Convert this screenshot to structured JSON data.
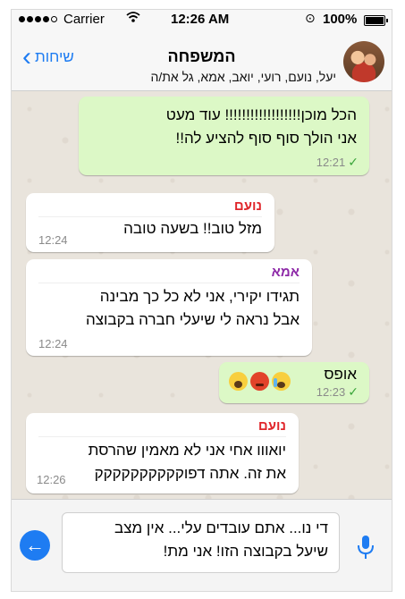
{
  "status_bar": {
    "carrier": "Carrier",
    "time": "12:26 AM",
    "battery": "100%"
  },
  "header": {
    "back_label": "שיחות",
    "title": "המשפחה",
    "members": "יעל, נועם, רועי, יואב, אמא, גל את/ה"
  },
  "messages": [
    {
      "direction": "out",
      "lines": [
        "הכל מוכן!!!!!!!!!!!!!!!!!! עוד מעט",
        "אני הולך סוף סוף להציע לה!!"
      ],
      "time": "12:21"
    },
    {
      "direction": "in",
      "sender": "נועם",
      "sender_color": "#e0262b",
      "lines": [
        "מזל טוב!! בשעה טובה"
      ],
      "time": "12:24"
    },
    {
      "direction": "in",
      "sender": "אמא",
      "sender_color": "#8e2aa8",
      "lines": [
        "תגידו יקירי, אני לא כל כך מבינה",
        "אבל נראה לי שיעלי חברה בקבוצה"
      ],
      "time": "12:24"
    },
    {
      "direction": "out",
      "lines": [
        "אופס"
      ],
      "emojis": [
        "face-screaming-in-fear",
        "pouting-face",
        "loudly-crying-face"
      ],
      "time": "12:23"
    },
    {
      "direction": "in",
      "sender": "נועם",
      "sender_color": "#e0262b",
      "lines": [
        "יואווו אחי אני לא מאמין שהרסת",
        "את זה. אתה דפוקקקקקקקקקק"
      ],
      "time": "12:26"
    }
  ],
  "composer": {
    "lines": [
      "די נו... אתם עובדים עלי... אין מצב",
      "שיעל בקבוצה הזו! אני מת!"
    ]
  },
  "colors": {
    "accent": "#1e7cf2",
    "outgoing_bubble": "#dcf8c6",
    "incoming_bubble": "#ffffff",
    "read_check": "#3aa53a"
  }
}
